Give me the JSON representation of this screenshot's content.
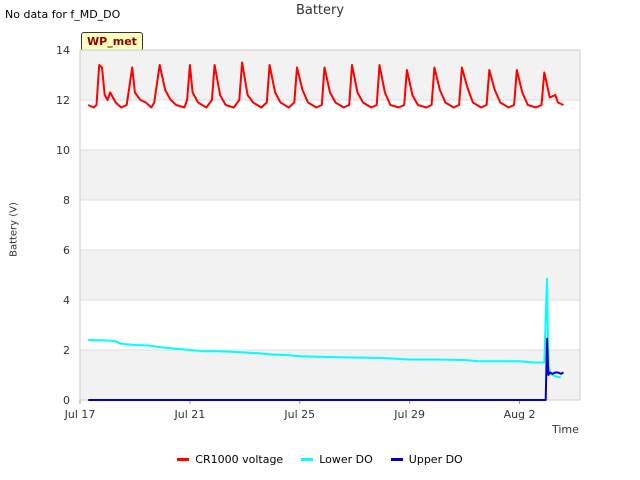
{
  "nodata_text": "No data for f_MD_DO",
  "badge": "WP_met",
  "chart_data": {
    "type": "line",
    "title": "Battery",
    "xlabel": "Time",
    "ylabel": "Battery (V)",
    "ylim": [
      0,
      14
    ],
    "yticks": [
      0,
      2,
      4,
      6,
      8,
      10,
      12,
      14
    ],
    "xlim": [
      0,
      18.2
    ],
    "xticks": [
      {
        "label": "Jul 17",
        "value": 0
      },
      {
        "label": "Jul 21",
        "value": 4
      },
      {
        "label": "Jul 25",
        "value": 8
      },
      {
        "label": "Jul 29",
        "value": 12
      },
      {
        "label": "Aug 2",
        "value": 16
      }
    ],
    "grid": true,
    "legend_position": "bottom",
    "series": [
      {
        "name": "CR1000 voltage",
        "color": "#ff0000",
        "x": [
          0.3,
          0.5,
          0.6,
          0.7,
          0.8,
          0.9,
          1.0,
          1.1,
          1.3,
          1.5,
          1.7,
          1.9,
          2.0,
          2.2,
          2.4,
          2.6,
          2.7,
          2.9,
          3.1,
          3.3,
          3.5,
          3.8,
          3.9,
          4.0,
          4.1,
          4.3,
          4.6,
          4.8,
          4.9,
          5.1,
          5.3,
          5.6,
          5.8,
          5.9,
          6.1,
          6.3,
          6.6,
          6.8,
          6.9,
          7.1,
          7.3,
          7.6,
          7.8,
          7.9,
          8.1,
          8.3,
          8.6,
          8.8,
          8.9,
          9.1,
          9.3,
          9.6,
          9.8,
          9.9,
          10.1,
          10.3,
          10.6,
          10.8,
          10.9,
          11.1,
          11.3,
          11.6,
          11.8,
          11.9,
          12.1,
          12.3,
          12.6,
          12.8,
          12.9,
          13.1,
          13.3,
          13.6,
          13.8,
          13.9,
          14.1,
          14.3,
          14.6,
          14.8,
          14.9,
          15.1,
          15.3,
          15.6,
          15.8,
          15.9,
          16.1,
          16.3,
          16.6,
          16.8,
          16.9,
          17.1,
          17.3,
          17.4,
          17.6
        ],
        "y": [
          11.8,
          11.7,
          11.8,
          13.4,
          13.3,
          12.2,
          12.0,
          12.3,
          11.9,
          11.7,
          11.8,
          13.3,
          12.3,
          12.0,
          11.9,
          11.7,
          11.9,
          13.4,
          12.4,
          12.0,
          11.8,
          11.7,
          12.0,
          13.4,
          12.3,
          11.9,
          11.7,
          12.0,
          13.4,
          12.2,
          11.8,
          11.7,
          12.0,
          13.5,
          12.2,
          11.9,
          11.7,
          11.9,
          13.4,
          12.3,
          11.9,
          11.7,
          11.9,
          13.3,
          12.4,
          11.9,
          11.7,
          11.8,
          13.3,
          12.3,
          11.9,
          11.7,
          11.8,
          13.4,
          12.3,
          11.9,
          11.7,
          11.8,
          13.4,
          12.3,
          11.8,
          11.7,
          11.8,
          13.2,
          12.2,
          11.8,
          11.7,
          11.8,
          13.3,
          12.4,
          11.9,
          11.7,
          11.8,
          13.3,
          12.5,
          11.9,
          11.7,
          11.8,
          13.2,
          12.4,
          11.9,
          11.7,
          11.8,
          13.2,
          12.3,
          11.8,
          11.7,
          11.8,
          13.1,
          12.1,
          12.2,
          11.9,
          11.8
        ]
      },
      {
        "name": "Lower DO",
        "color": "#00ffff",
        "x": [
          0.3,
          1.0,
          1.3,
          1.5,
          2.0,
          2.5,
          3.0,
          3.5,
          4.0,
          4.5,
          5.0,
          5.5,
          6.0,
          6.5,
          7.0,
          7.5,
          8.0,
          9.0,
          10.0,
          11.0,
          12.0,
          13.0,
          14.0,
          14.5,
          15.0,
          15.5,
          16.0,
          16.5,
          16.9,
          17.0,
          17.05,
          17.1,
          17.2,
          17.3,
          17.5
        ],
        "y": [
          2.4,
          2.38,
          2.35,
          2.25,
          2.2,
          2.18,
          2.1,
          2.05,
          2.0,
          1.95,
          1.95,
          1.93,
          1.9,
          1.87,
          1.82,
          1.8,
          1.75,
          1.72,
          1.7,
          1.68,
          1.62,
          1.62,
          1.6,
          1.55,
          1.55,
          1.55,
          1.55,
          1.5,
          1.5,
          4.85,
          1.4,
          1.1,
          1.0,
          0.95,
          0.9
        ]
      },
      {
        "name": "Upper DO",
        "color": "#0000cc",
        "x": [
          0.3,
          16.95,
          17.0,
          17.05,
          17.1,
          17.2,
          17.3,
          17.4,
          17.5,
          17.6
        ],
        "y": [
          0.0,
          0.0,
          2.45,
          1.0,
          1.1,
          1.05,
          1.1,
          1.1,
          1.05,
          1.1
        ]
      }
    ]
  }
}
